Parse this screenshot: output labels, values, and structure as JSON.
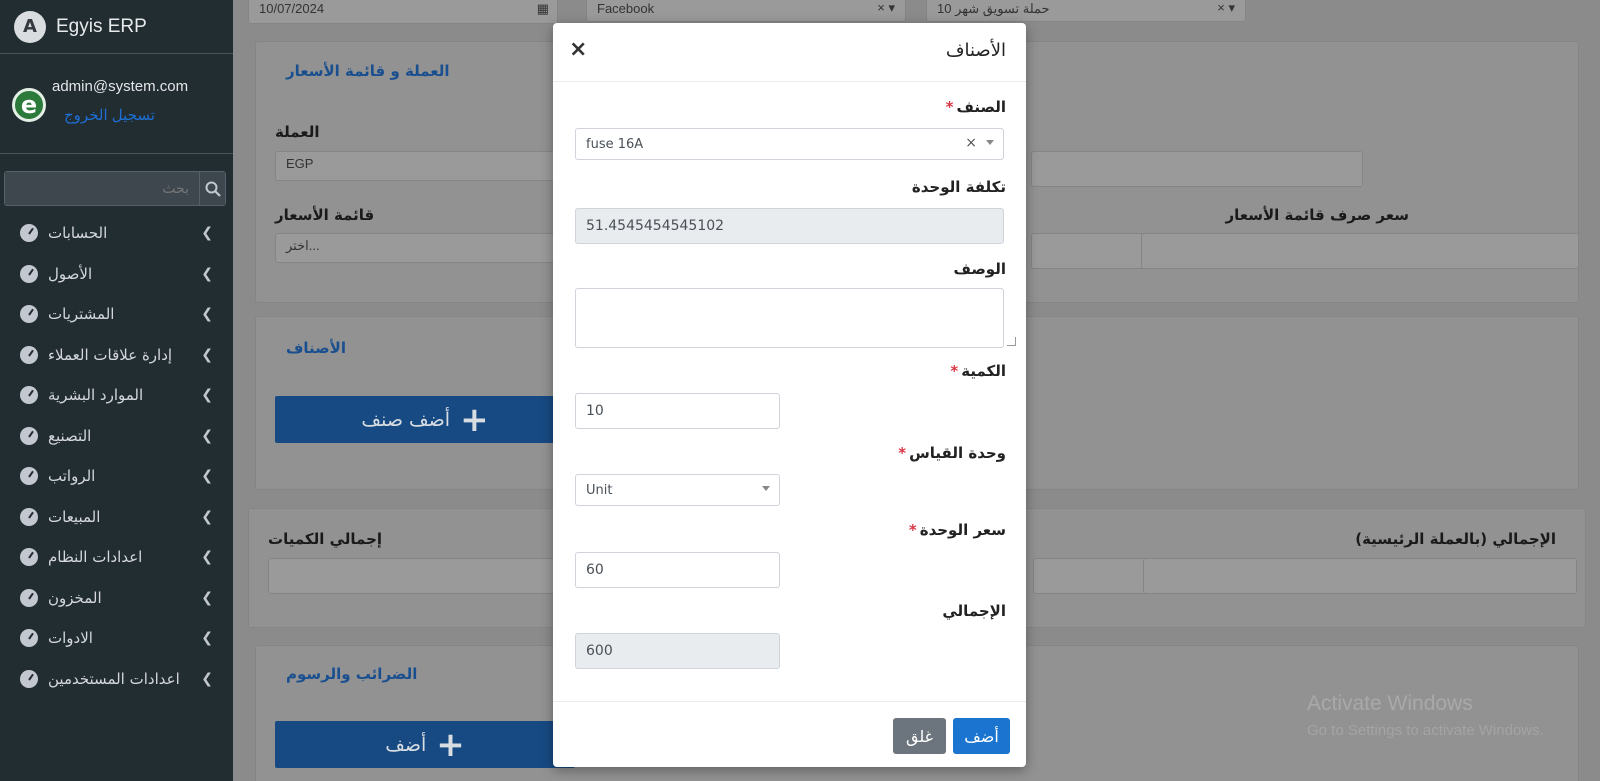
{
  "sidebar": {
    "brand": "Egyis ERP",
    "brand_logo": "A",
    "user_email": "admin@system.com",
    "logout": "تسجيل الخروج",
    "search_placeholder": "بحث",
    "items": [
      {
        "label": "الحسابات"
      },
      {
        "label": "الأصول"
      },
      {
        "label": "المشتريات"
      },
      {
        "label": "إدارة علاقات العملاء"
      },
      {
        "label": "الموارد البشرية"
      },
      {
        "label": "التصنيع"
      },
      {
        "label": "الرواتب"
      },
      {
        "label": "المبيعات"
      },
      {
        "label": "اعدادات النظام"
      },
      {
        "label": "المخزون"
      },
      {
        "label": "الادوات"
      },
      {
        "label": "اعدادات المستخدمين"
      }
    ]
  },
  "background": {
    "date_value": "10/07/2024",
    "source_value": "Facebook",
    "campaign_value": "حملة تسويق شهر 10",
    "currency_card_title": "العملة و قائمة الأسعار",
    "currency_label": "العملة",
    "currency_value": "EGP",
    "pricelist_label": "قائمة الأسعار",
    "pricelist_placeholder": "اختر...",
    "pricelist_rate_label": "سعر صرف قائمة الأسعار",
    "items_card_title": "الأصناف",
    "add_item_button": "أضف صنف",
    "total_qty_label": "إجمالي الكميات",
    "total_main_currency_label": "الإجمالي (بالعملة الرئيسية)",
    "taxes_card_title": "الضرائب والرسوم",
    "add_button": "أضف"
  },
  "watermark": {
    "title": "Activate Windows",
    "subtitle": "Go to Settings to activate Windows."
  },
  "modal": {
    "title": "الأصناف",
    "item_label": "الصنف",
    "item_value": "fuse 16A",
    "unit_cost_label": "تكلفة الوحدة",
    "unit_cost_value": "51.4545454545102",
    "description_label": "الوصف",
    "description_value": "",
    "quantity_label": "الكمية",
    "quantity_value": "10",
    "uom_label": "وحدة القياس",
    "uom_value": "Unit",
    "unit_price_label": "سعر الوحدة",
    "unit_price_value": "60",
    "total_label": "الإجمالي",
    "total_value": "600",
    "add_button": "أضف",
    "close_button": "غلق",
    "required_mark": "*"
  }
}
